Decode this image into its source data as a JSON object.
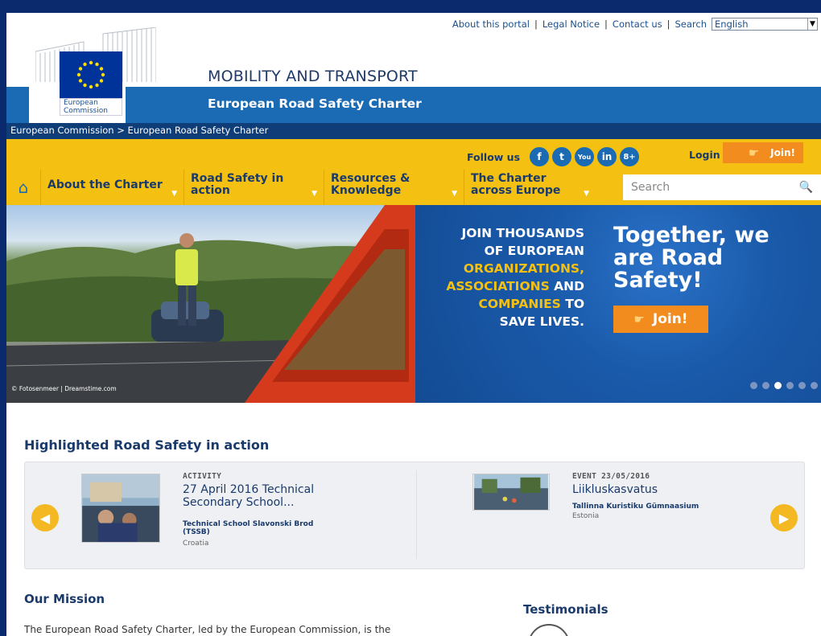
{
  "top_links": {
    "about": "About this portal",
    "legal": "Legal Notice",
    "contact": "Contact us",
    "search": "Search",
    "language": "English"
  },
  "logo": {
    "line1": "European",
    "line2": "Commission"
  },
  "site_title": "MOBILITY AND TRANSPORT",
  "subtitle": "European Road Safety Charter",
  "breadcrumb": "European Commission > European Road Safety Charter",
  "social": {
    "follow_label": "Follow us",
    "icons": [
      "f",
      "t",
      "You",
      "in",
      "8+"
    ]
  },
  "login": "Login",
  "join_small": "Join!",
  "nav": [
    {
      "l1": "About the Charter",
      "l2": ""
    },
    {
      "l1": "Road Safety in",
      "l2": "action"
    },
    {
      "l1": "Resources &",
      "l2": "Knowledge"
    },
    {
      "l1": "The Charter",
      "l2": "across Europe"
    }
  ],
  "search_placeholder": "Search",
  "hero": {
    "line1": "JOIN THOUSANDS",
    "line2": "OF EUROPEAN",
    "line3": "ORGANIZATIONS,",
    "line4a": "ASSOCIATIONS",
    "line4b": " AND",
    "line5a": "COMPANIES",
    "line5b": " TO",
    "line6": "SAVE LIVES.",
    "big1": "Together, we",
    "big2": "are Road",
    "big3": "Safety!",
    "join": "Join!",
    "credit": "© Fotosenmeer | Dreamstime.com"
  },
  "highlight": {
    "title": "Highlighted Road Safety in action",
    "cards": [
      {
        "meta": "ACTIVITY",
        "title1": "27 April 2016 Technical",
        "title2": "Secondary School...",
        "org1": "Technical School Slavonski Brod",
        "org2": "(TSSB)",
        "country": "Croatia"
      },
      {
        "meta": "EVENT 23/05/2016",
        "title1": "Liikluskasvatus",
        "org1": "Tallinna Kuristiku Gümnaasium",
        "country": "Estonia"
      }
    ]
  },
  "mission": {
    "title": "Our Mission",
    "text": "The European Road Safety Charter, led by the European Commission, is the"
  },
  "testimonials": {
    "title": "Testimonials"
  }
}
